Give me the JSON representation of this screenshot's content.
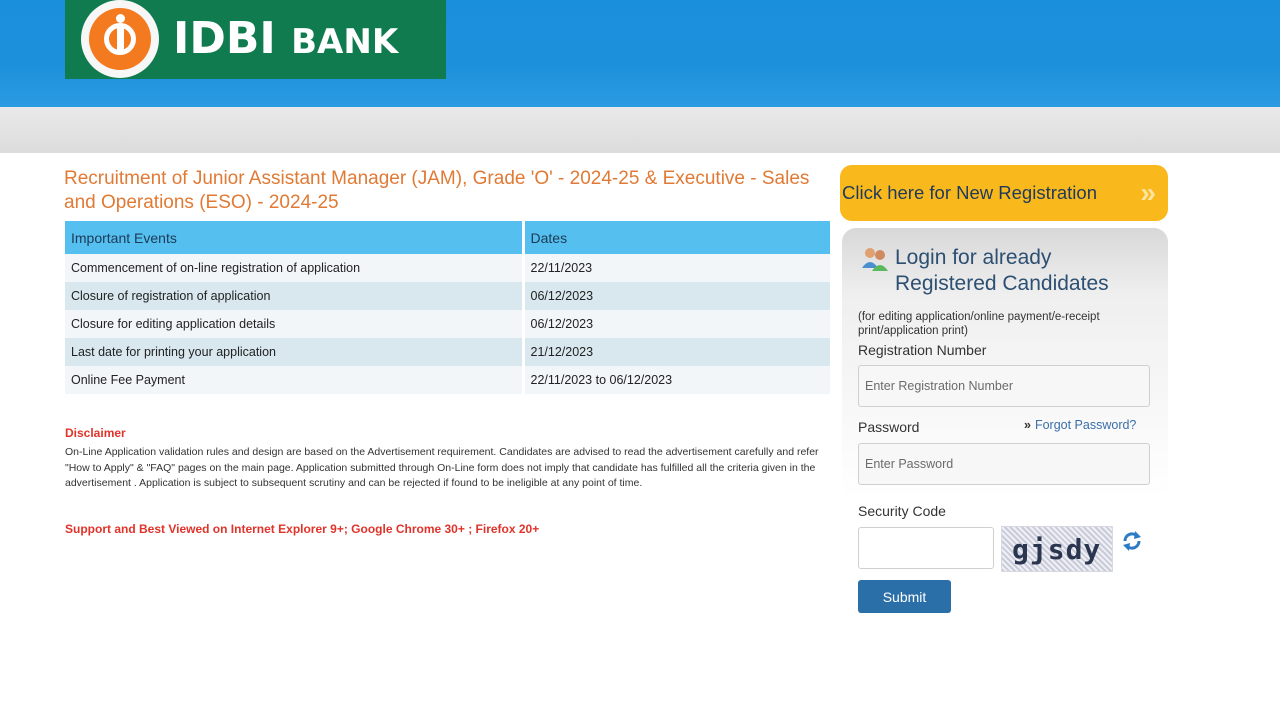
{
  "header": {
    "logo_text_main": "IDBI",
    "logo_text_small": "BANK"
  },
  "main": {
    "title": "Recruitment of Junior Assistant Manager (JAM), Grade 'O' - 2024-25 & Executive - Sales and Operations (ESO) - 2024-25",
    "table": {
      "headers": [
        "Important Events",
        "Dates"
      ],
      "rows": [
        [
          "Commencement of on-line registration of application",
          "22/11/2023"
        ],
        [
          "Closure of registration of application",
          "06/12/2023"
        ],
        [
          "Closure for editing application details",
          "06/12/2023"
        ],
        [
          "Last date for printing your application",
          "21/12/2023"
        ],
        [
          "Online Fee Payment",
          "22/11/2023 to 06/12/2023"
        ]
      ]
    },
    "disclaimer_heading": "Disclaimer",
    "disclaimer_text": "On-Line Application validation rules and design are based on the Advertisement requirement. Candidates are advised to read the advertisement carefully and refer \"How to Apply\" & \"FAQ\" pages on the main page. Application submitted through On-Line form does not imply that candidate has fulfilled all the criteria given in the advertisement . Application is subject to subsequent scrutiny and can be rejected if found to be ineligible at any point of time.",
    "support_text": "Support and Best Viewed on Internet Explorer 9+; Google Chrome 30+ ; Firefox 20+"
  },
  "sidebar": {
    "new_registration_label": "Click here for New Registration",
    "new_registration_chevron": "»",
    "login_title": "Login for already Registered Candidates",
    "login_note": "(for editing application/online payment/e-receipt print/application print)",
    "registration_label": "Registration Number",
    "registration_placeholder": "Enter Registration Number",
    "password_label": "Password",
    "forgot_arrow": "»",
    "forgot_label": "Forgot Password?",
    "password_placeholder": "Enter Password",
    "security_label": "Security Code",
    "security_value": "",
    "captcha_text": "gjsdy",
    "submit_label": "Submit"
  },
  "colors": {
    "header_blue": "#1d90db",
    "logo_green": "#107b4f",
    "logo_orange": "#f47a20",
    "title_orange": "#e07a35",
    "table_header": "#55bff0",
    "disclaimer_red": "#e0332a",
    "new_reg_yellow": "#f9b91c",
    "submit_blue": "#2b6fa8"
  }
}
